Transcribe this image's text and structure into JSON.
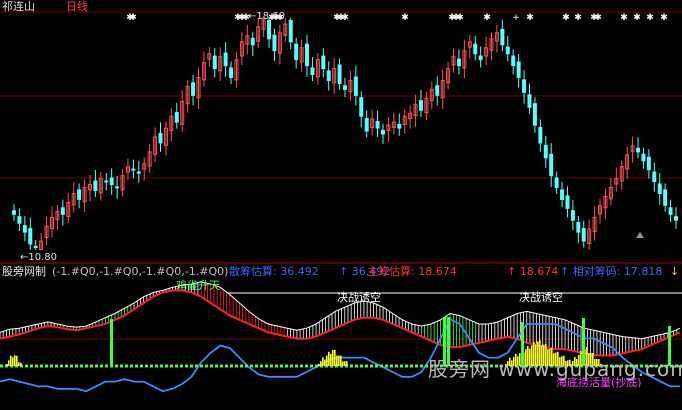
{
  "header": {
    "stock_name": "祁连山",
    "period": "日线"
  },
  "price_labels": {
    "high": "←18.60",
    "low": "←10.80"
  },
  "indicator": {
    "name": "股旁网制",
    "params": "(-1.#Q0,-1.#Q0,-1.#Q0,-1.#Q0)",
    "f1": "散筹估算: 36.492",
    "f1_arrow": "↑ 36.492",
    "f2": "主筹估算: 18.674",
    "f2_arrow": "↑ 18.674",
    "f3": "↑ 相对筹码: 17.818",
    "f3_arrow": "↓ 亏",
    "annotations": {
      "rise": "鸡雀升天",
      "lure1": "决战诱空",
      "lure2": "决战诱空"
    },
    "caption": "海底捞活量(抄底)"
  },
  "watermark": "股旁网 www.gupang.com",
  "colors": {
    "up": "#ff5050",
    "down": "#54ffff",
    "blue": "#3c8cff",
    "red": "#ff2020",
    "green": "#40ff40",
    "yellow": "#ffff20",
    "grid": "#7a0000"
  },
  "chart_data": [
    {
      "type": "candlestick",
      "title": "祁连山 日线",
      "annotations": {
        "high": 18.6,
        "low": 10.8
      },
      "closes": [
        12.0,
        11.7,
        11.4,
        11.0,
        10.9,
        11.1,
        11.6,
        11.9,
        12.1,
        12.0,
        12.4,
        12.7,
        12.5,
        12.9,
        13.0,
        12.8,
        13.2,
        13.1,
        13.0,
        12.9,
        13.3,
        13.6,
        13.5,
        13.4,
        13.7,
        14.1,
        14.6,
        14.4,
        14.9,
        15.3,
        15.1,
        15.8,
        16.3,
        16.0,
        16.6,
        17.1,
        17.4,
        16.9,
        17.3,
        17.0,
        16.6,
        17.2,
        17.8,
        18.0,
        17.7,
        18.3,
        18.6,
        17.9,
        17.5,
        18.1,
        18.4,
        17.8,
        17.2,
        17.6,
        17.0,
        16.7,
        17.2,
        16.9,
        16.5,
        16.9,
        16.4,
        16.2,
        16.5,
        16.0,
        15.3,
        14.8,
        15.2,
        14.9,
        14.7,
        15.0,
        15.1,
        14.9,
        15.3,
        15.4,
        15.7,
        15.5,
        15.9,
        16.2,
        16.0,
        16.5,
        16.9,
        17.3,
        17.0,
        17.5,
        17.8,
        17.4,
        17.2,
        17.6,
        17.9,
        18.1,
        17.7,
        17.4,
        17.0,
        16.6,
        16.1,
        15.6,
        15.0,
        14.4,
        13.9,
        13.3,
        12.9,
        12.5,
        12.2,
        11.8,
        11.4,
        11.1,
        11.5,
        11.9,
        12.3,
        12.6,
        12.9,
        13.2,
        13.6,
        14.0,
        14.3,
        14.1,
        13.8,
        13.5,
        13.1,
        12.7,
        12.3,
        12.0,
        11.8
      ]
    },
    {
      "type": "line",
      "title": "股旁网制",
      "series": [
        {
          "name": "散筹估算",
          "values": [
            32,
            35,
            36,
            38,
            40,
            42,
            40,
            38,
            37,
            38,
            42,
            46,
            50,
            55,
            60,
            66,
            70,
            72,
            75,
            77,
            78,
            80,
            78,
            75,
            68,
            60,
            52,
            45,
            40,
            38,
            36,
            34,
            36,
            40,
            46,
            52,
            56,
            60,
            62,
            60,
            56,
            50,
            44,
            40,
            38,
            40,
            44,
            50,
            48,
            44,
            40,
            40,
            42,
            46,
            50,
            52,
            50,
            48,
            46,
            44,
            40,
            36,
            34,
            32,
            30,
            28,
            27,
            26,
            28,
            30,
            32,
            36
          ]
        },
        {
          "name": "主筹估算",
          "values": [
            26,
            28,
            30,
            33,
            36,
            38,
            37,
            35,
            34,
            36,
            38,
            40,
            44,
            48,
            54,
            60,
            66,
            70,
            72,
            72,
            70,
            66,
            60,
            54,
            48,
            44,
            40,
            36,
            32,
            30,
            28,
            26,
            26,
            28,
            32,
            36,
            40,
            44,
            46,
            46,
            44,
            40,
            36,
            32,
            28,
            24,
            20,
            18,
            18,
            20,
            22,
            24,
            26,
            28,
            26,
            22,
            20,
            18,
            16,
            16,
            14,
            12,
            10,
            10,
            10,
            12,
            14,
            16,
            20,
            24,
            28,
            32
          ]
        },
        {
          "name": "相对筹码",
          "values": [
            6,
            7,
            6,
            5,
            4,
            4,
            3,
            3,
            3,
            2,
            4,
            6,
            6,
            7,
            6,
            6,
            4,
            2,
            3,
            5,
            8,
            14,
            18,
            21,
            20,
            16,
            12,
            9,
            8,
            8,
            8,
            8,
            10,
            12,
            14,
            16,
            16,
            16,
            16,
            14,
            12,
            10,
            8,
            8,
            10,
            16,
            24,
            32,
            30,
            24,
            18,
            16,
            16,
            18,
            24,
            30,
            30,
            30,
            30,
            28,
            26,
            24,
            24,
            22,
            20,
            16,
            13,
            10,
            8,
            6,
            4,
            4
          ]
        }
      ]
    }
  ]
}
